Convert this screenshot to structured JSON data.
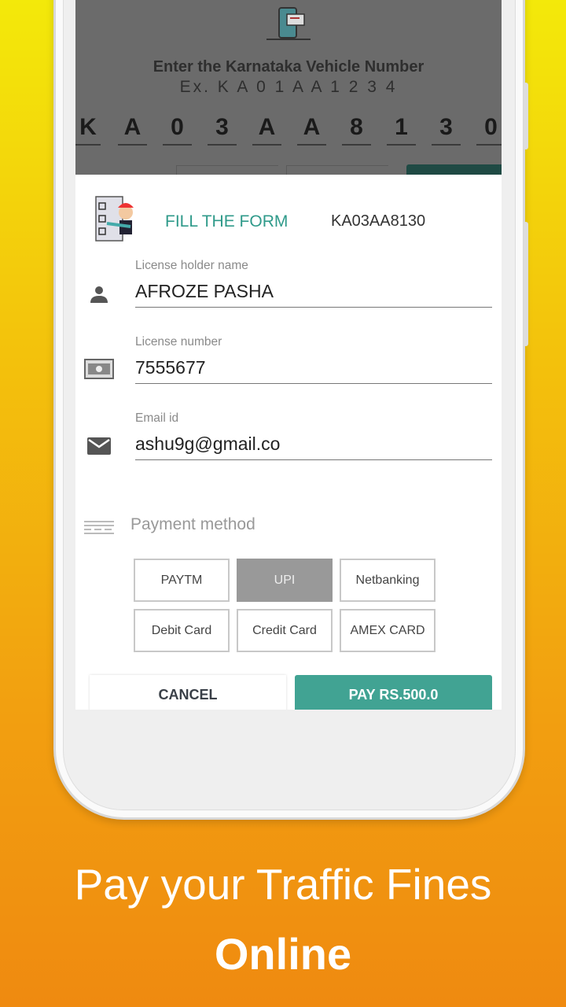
{
  "top_overlay": {
    "title": "Enter the Karnataka Vehicle Number",
    "example": "Ex. K A 0 1 A A 1 2 3 4",
    "chars": [
      "K",
      "A",
      "0",
      "3",
      "A",
      "A",
      "8",
      "1",
      "3",
      "0"
    ]
  },
  "form": {
    "heading": "FILL THE FORM",
    "vehicle_number": "KA03AA8130",
    "fields": [
      {
        "label": "License holder name",
        "value": "AFROZE PASHA",
        "icon": "person-icon"
      },
      {
        "label": "License number",
        "value": "7555677",
        "icon": "license-card-icon"
      },
      {
        "label": "Email id",
        "value": "ashu9g@gmail.co",
        "icon": "email-icon"
      }
    ],
    "payment_label": "Payment method",
    "payment_options": [
      "PAYTM",
      "UPI",
      "Netbanking",
      "Debit Card",
      "Credit Card",
      "AMEX CARD"
    ],
    "selected_payment": "UPI",
    "cancel": "CANCEL",
    "pay": "PAY RS.500.0"
  },
  "colors": {
    "accent": "#41a393",
    "selected": "#999999"
  },
  "caption": {
    "line1": "Pay your Traffic Fines",
    "line2": "Online"
  }
}
